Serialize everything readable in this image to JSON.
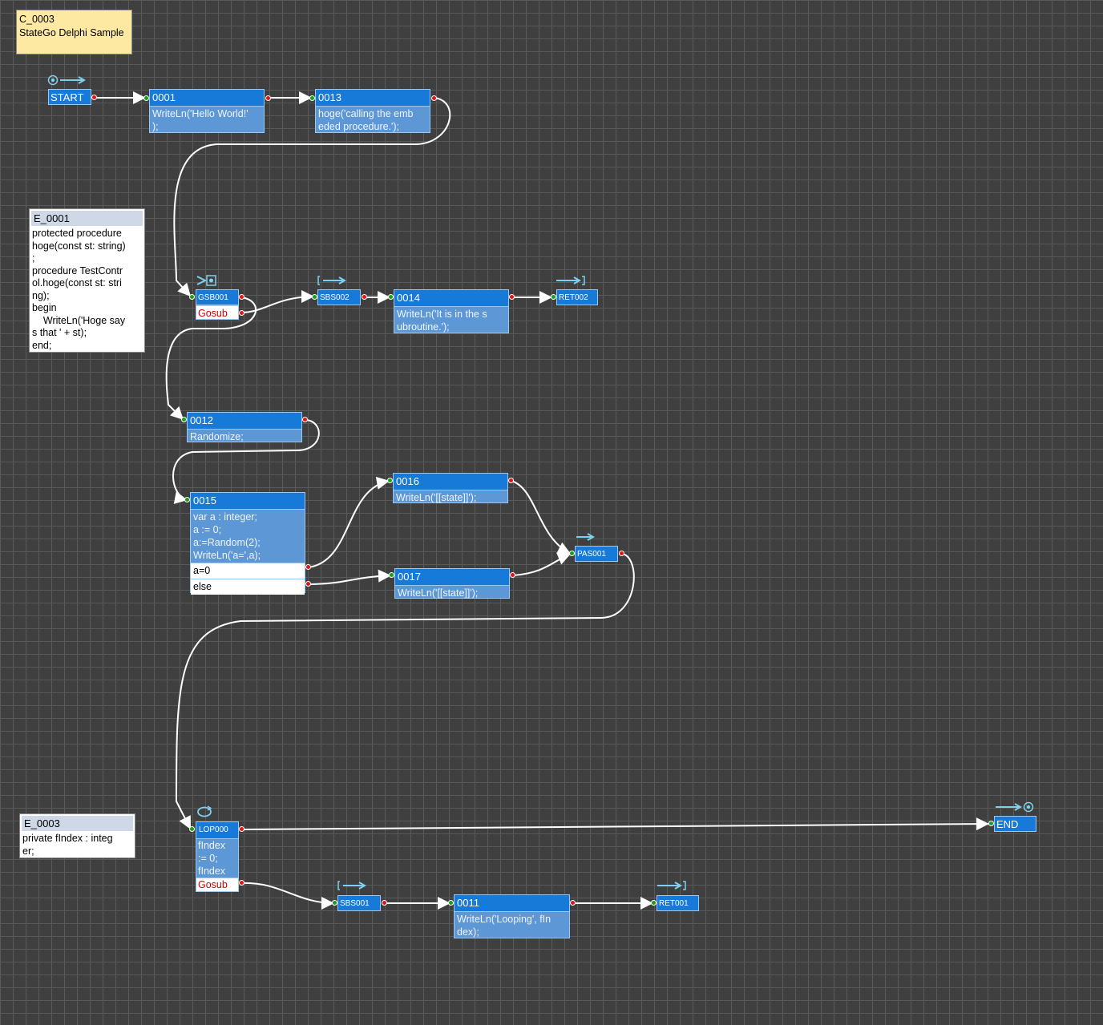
{
  "comment": {
    "id": "C_0003",
    "text": "StateGo Delphi Sample"
  },
  "notes": {
    "e0001": {
      "title": "E_0001",
      "lines": [
        "protected procedure",
        "hoge(const st: string)",
        ";",
        "procedure TestContr",
        "ol.hoge(const st: stri",
        "ng);",
        "begin",
        "    WriteLn('Hoge say",
        "s that ' + st);",
        "end;"
      ]
    },
    "e0003": {
      "title": "E_0003",
      "lines": [
        "private fIndex : integ",
        "er;"
      ]
    }
  },
  "states": {
    "start": {
      "label": "START"
    },
    "s0001": {
      "id": "0001",
      "lines": [
        "WriteLn('Hello World!'",
        ");"
      ]
    },
    "s0013": {
      "id": "0013",
      "lines": [
        "hoge('calling the emb",
        "eded procedure.');"
      ]
    },
    "gsb001": {
      "label": "GSB001",
      "gosub": "Gosub"
    },
    "sbs002": {
      "label": "SBS002"
    },
    "s0014": {
      "id": "0014",
      "lines": [
        "WriteLn('It is in the s",
        "ubroutine.');"
      ]
    },
    "ret002": {
      "label": "RET002"
    },
    "s0012": {
      "id": "0012",
      "lines": [
        "Randomize;"
      ]
    },
    "s0015": {
      "id": "0015",
      "lines": [
        "var a : integer;",
        "a := 0;",
        "a:=Random(2);",
        "WriteLn('a=',a);"
      ],
      "branch1": "a=0",
      "branch2": "else"
    },
    "s0016": {
      "id": "0016",
      "lines": [
        "WriteLn('[[state]]');"
      ]
    },
    "s0017": {
      "id": "0017",
      "lines": [
        "WriteLn('[[state]]');"
      ]
    },
    "pas001": {
      "label": "PAS001"
    },
    "lop000": {
      "label": "LOP000",
      "lines": [
        "fIndex",
        ":= 0;",
        "fIndex"
      ],
      "gosub": "Gosub"
    },
    "end": {
      "label": "END"
    },
    "sbs001": {
      "label": "SBS001"
    },
    "s0011": {
      "id": "0011",
      "lines": [
        "WriteLn('Looping', fIn",
        "dex);"
      ]
    },
    "ret001": {
      "label": "RET001"
    }
  },
  "colors": {
    "header": "#1779d8",
    "body": "#5e97d6",
    "in_port": "#16a016",
    "out_port": "#e01515",
    "wire": "#ffffff",
    "comment": "#fde9a2"
  }
}
